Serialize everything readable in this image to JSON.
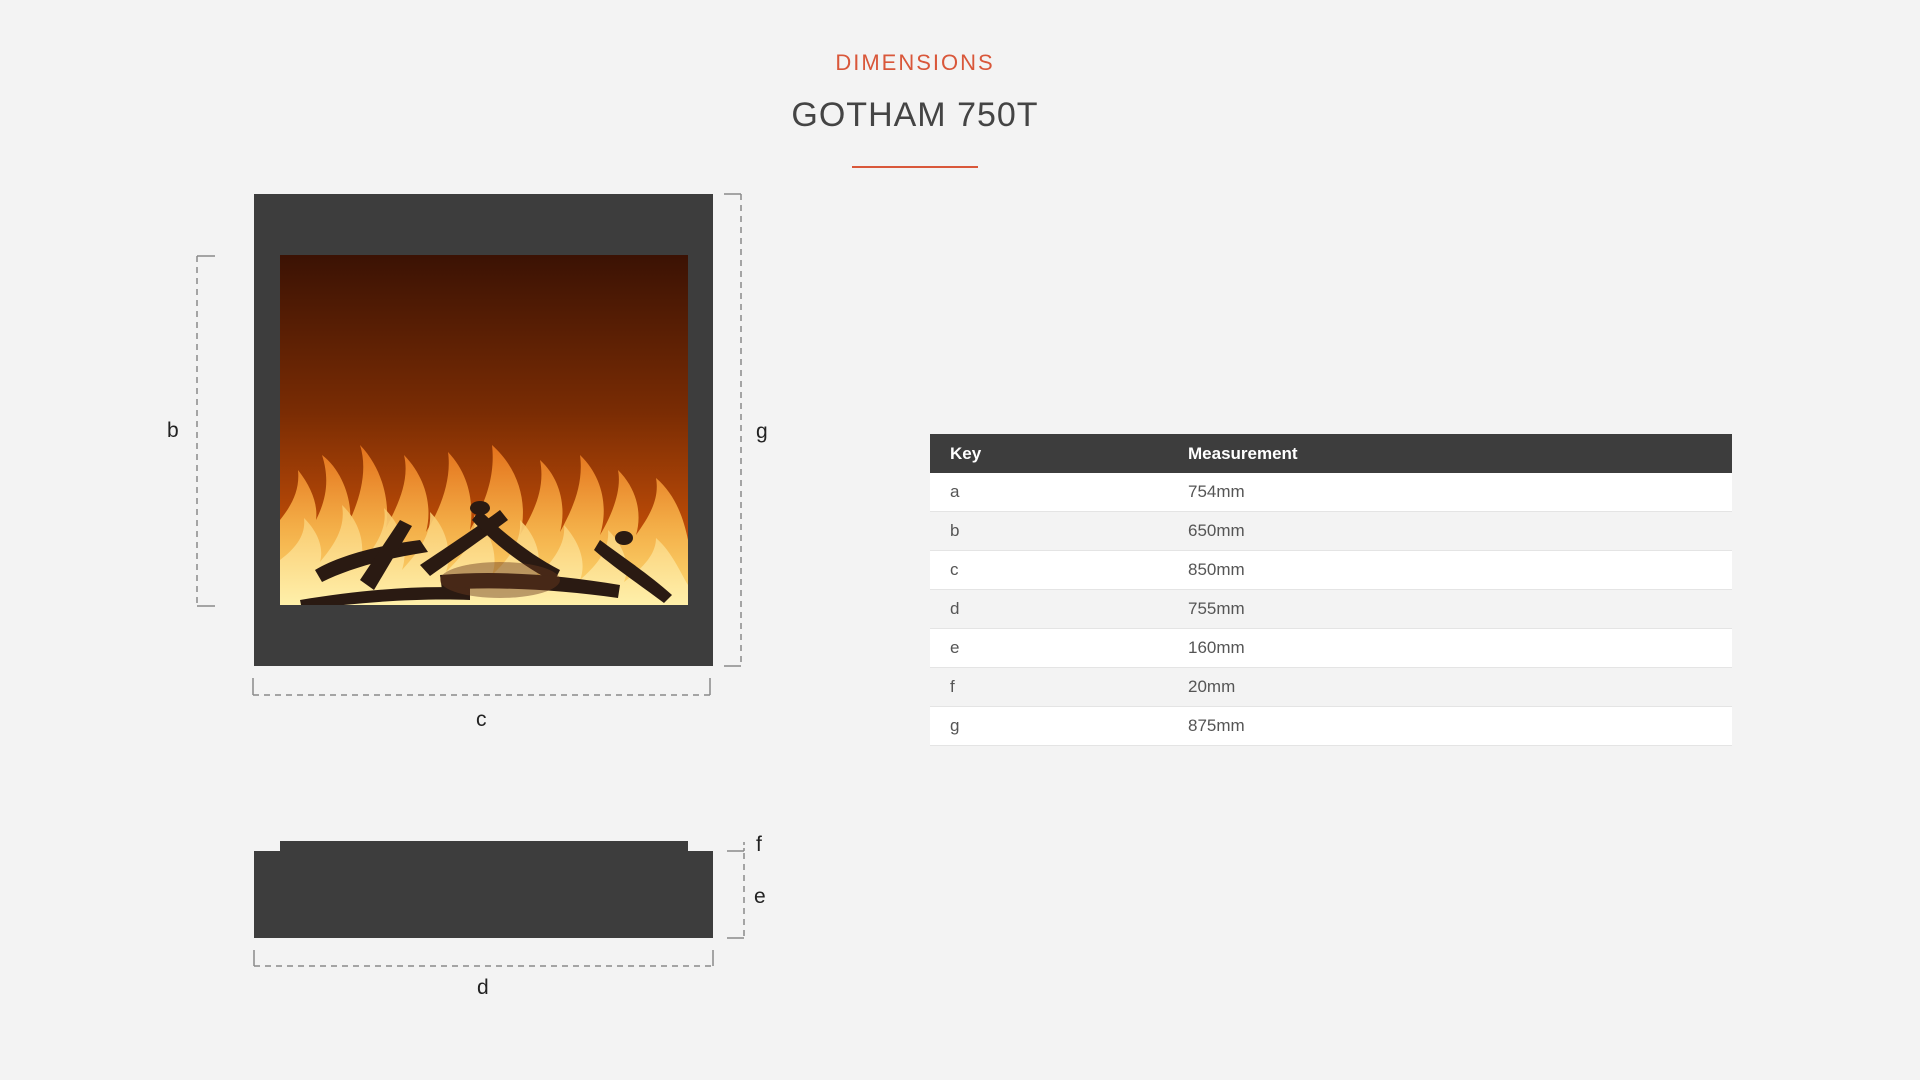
{
  "header": {
    "eyebrow": "DIMENSIONS",
    "title": "GOTHAM 750T"
  },
  "diagram": {
    "labels": {
      "b": "b",
      "c": "c",
      "g": "g",
      "f": "f",
      "e": "e",
      "d": "d"
    }
  },
  "table": {
    "headers": {
      "key": "Key",
      "measurement": "Measurement"
    },
    "rows": [
      {
        "key": "a",
        "measurement": "754mm"
      },
      {
        "key": "b",
        "measurement": "650mm"
      },
      {
        "key": "c",
        "measurement": "850mm"
      },
      {
        "key": "d",
        "measurement": "755mm"
      },
      {
        "key": "e",
        "measurement": "160mm"
      },
      {
        "key": "f",
        "measurement": "20mm"
      },
      {
        "key": "g",
        "measurement": "875mm"
      }
    ]
  },
  "colors": {
    "accent": "#d9573a",
    "frame": "#3d3d3d",
    "header_bg": "#3d3d3d",
    "background": "#f3f3f3"
  }
}
